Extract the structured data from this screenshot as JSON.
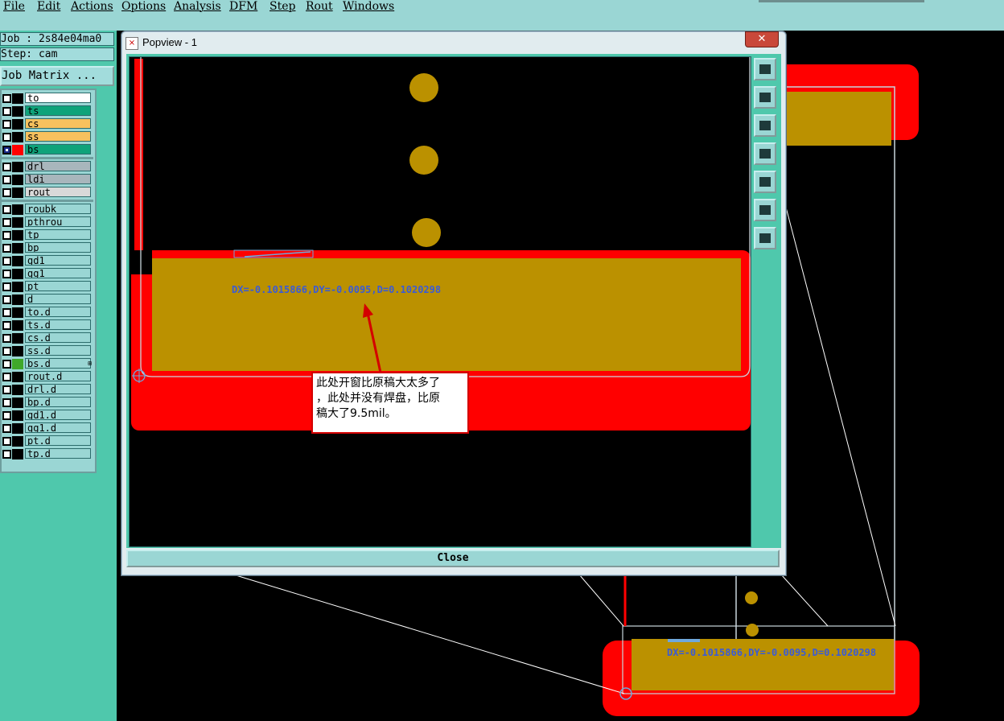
{
  "menubar": {
    "items": [
      {
        "label": "File"
      },
      {
        "label": "Edit"
      },
      {
        "label": "Actions"
      },
      {
        "label": "Options"
      },
      {
        "label": "Analysis"
      },
      {
        "label": "DFM"
      },
      {
        "label": "Step"
      },
      {
        "label": "Rout"
      },
      {
        "label": "Windows"
      }
    ]
  },
  "job": {
    "job_label": "Job : 2s84e04ma0",
    "step_label": "Step: cam",
    "matrix_button": "Job Matrix ..."
  },
  "layers": {
    "group1": [
      {
        "name": "to",
        "bg": "#ffffff",
        "swatch": "#000000"
      },
      {
        "name": "ts",
        "bg": "#0fa37a",
        "swatch": "#000000"
      },
      {
        "name": "cs",
        "bg": "#f7c15e",
        "swatch": "#000000"
      },
      {
        "name": "ss",
        "bg": "#f7c15e",
        "swatch": "#000000"
      },
      {
        "name": "bs",
        "bg": "#0fa37a",
        "swatch": "#ff0000",
        "active": true
      }
    ],
    "group2": [
      {
        "name": "drl",
        "bg": "#a8b6bc",
        "swatch": "#000000"
      },
      {
        "name": "ldi",
        "bg": "#a8b6bc",
        "swatch": "#000000"
      },
      {
        "name": "rout",
        "bg": "#d9d9d9",
        "swatch": "#000000"
      }
    ],
    "group3": [
      {
        "name": "roubk"
      },
      {
        "name": "pthrou"
      },
      {
        "name": "tp"
      },
      {
        "name": "bp"
      },
      {
        "name": "gd1"
      },
      {
        "name": "gg1"
      },
      {
        "name": "pt"
      },
      {
        "name": "d"
      },
      {
        "name": "to.d"
      },
      {
        "name": "ts.d"
      },
      {
        "name": "cs.d"
      },
      {
        "name": "ss.d"
      },
      {
        "name": "bs.d",
        "swatch": "#3fa82a",
        "extra": "⊞"
      },
      {
        "name": "rout.d"
      },
      {
        "name": "drl.d"
      },
      {
        "name": "bp.d"
      },
      {
        "name": "gd1.d"
      },
      {
        "name": "gg1.d"
      },
      {
        "name": "pt.d"
      },
      {
        "name": "tp.d"
      }
    ]
  },
  "popup": {
    "title": "Popview - 1",
    "close_x": "✕",
    "close_button": "Close"
  },
  "measurement": {
    "text": "DX=-0.1015866,DY=-0.0095,D=0.1020298",
    "color": "#3a5bd6"
  },
  "annotation": {
    "line1": "此处开窗比原稿大太多了",
    "line2": "，此处并没有焊盘，比原",
    "line3": "稿大了9.5mil。"
  },
  "colors": {
    "teal_panel": "#4fc8ac",
    "light_teal": "#9ad6d4",
    "mask_red": "#ff0000",
    "copper_gold": "#bb9100"
  }
}
